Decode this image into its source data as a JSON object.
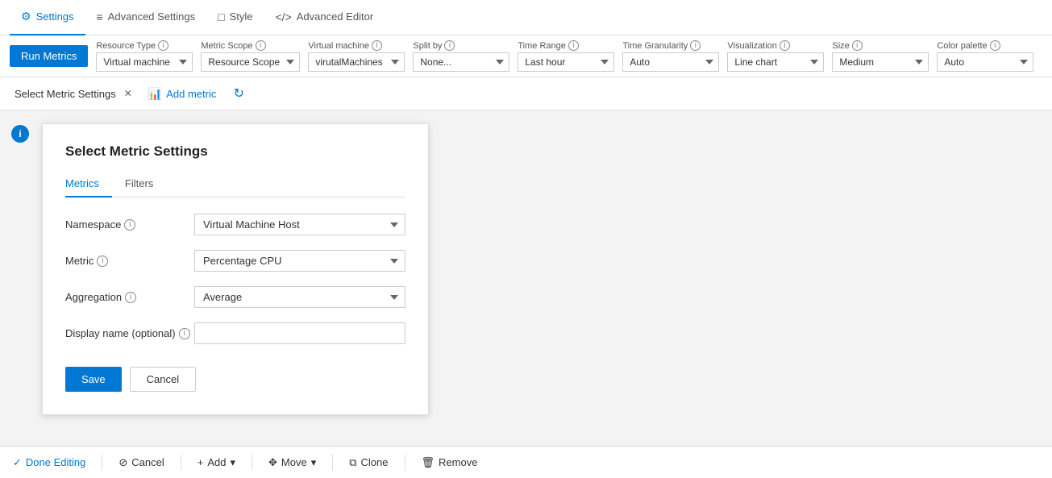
{
  "topTabs": [
    {
      "id": "settings",
      "label": "Settings",
      "icon": "⚙",
      "active": true
    },
    {
      "id": "advanced-settings",
      "label": "Advanced Settings",
      "icon": "≡",
      "active": false
    },
    {
      "id": "style",
      "label": "Style",
      "icon": "□",
      "active": false
    },
    {
      "id": "advanced-editor",
      "label": "Advanced Editor",
      "icon": "</>",
      "active": false
    }
  ],
  "toolbar": {
    "runMetricsLabel": "Run Metrics",
    "resourceTypeLabel": "Resource Type",
    "resourceTypeValue": "Virtual machine",
    "metricScopeLabel": "Metric Scope",
    "metricScopeValue": "Resource Scope",
    "virtualMachineLabel": "Virtual machine",
    "virtualMachineValue": "virutalMachines",
    "splitByLabel": "Split by",
    "splitByValue": "None...",
    "timeRangeLabel": "Time Range",
    "timeRangeValue": "Last hour",
    "timeGranularityLabel": "Time Granularity",
    "timeGranularityValue": "Auto",
    "visualizationLabel": "Visualization",
    "visualizationValue": "Line chart",
    "sizeLabel": "Size",
    "sizeValue": "Medium",
    "colorPaletteLabel": "Color palette",
    "colorPaletteValue": "Auto"
  },
  "metricsBar": {
    "tabLabel": "Select Metric Settings",
    "addMetricLabel": "Add metric",
    "refreshIcon": "↻"
  },
  "panel": {
    "title": "Select Metric Settings",
    "tabs": [
      {
        "id": "metrics",
        "label": "Metrics",
        "active": true
      },
      {
        "id": "filters",
        "label": "Filters",
        "active": false
      }
    ],
    "namespaceLabel": "Namespace",
    "namespaceValue": "Virtual Machine Host",
    "metricLabel": "Metric",
    "metricValue": "Percentage CPU",
    "aggregationLabel": "Aggregation",
    "aggregationValue": "Average",
    "displayNameLabel": "Display name (optional)",
    "displayNameValue": "",
    "displayNamePlaceholder": "",
    "saveLabel": "Save",
    "cancelLabel": "Cancel"
  },
  "bottomBar": {
    "doneEditingLabel": "Done Editing",
    "cancelLabel": "Cancel",
    "addLabel": "Add",
    "moveLabel": "Move",
    "cloneLabel": "Clone",
    "removeLabel": "Remove"
  }
}
